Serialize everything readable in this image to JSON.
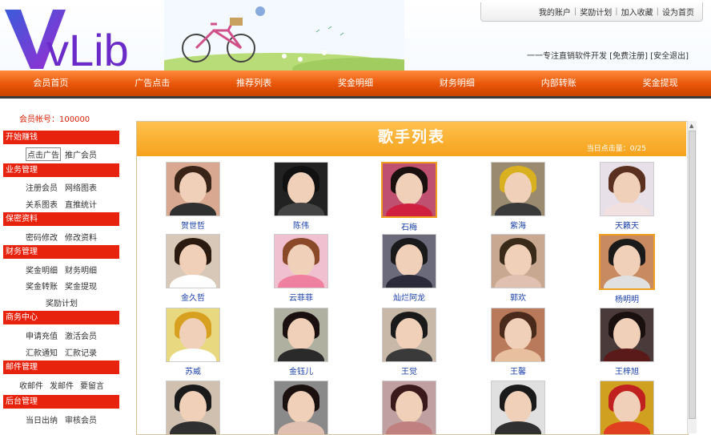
{
  "brand": {
    "logo_text": "vLib",
    "logo_v_color": "#3a2fc0",
    "accent": "#e85508"
  },
  "top_links": [
    "我的账户",
    "奖励计划",
    "加入收藏",
    "设为首页"
  ],
  "slogan": {
    "text": "一一专注直销软件开发",
    "links": [
      "[免费注册]",
      "[安全退出]"
    ]
  },
  "nav": [
    "会员首页",
    "广告点击",
    "推荐列表",
    "奖金明细",
    "财务明细",
    "内部转账",
    "奖金提现"
  ],
  "sidebar": {
    "account_label": "会员帐号：100000",
    "sections": [
      {
        "title": "开始赚钱",
        "items": [
          "点击广告",
          "推广会员"
        ]
      },
      {
        "title": "业务管理",
        "items": [
          "注册会员",
          "网络图表",
          "关系图表",
          "直推统计"
        ]
      },
      {
        "title": "保密资料",
        "items": [
          "密码修改",
          "修改资料"
        ]
      },
      {
        "title": "财务管理",
        "items": [
          "奖金明细",
          "财务明细",
          "奖金转账",
          "奖金提现",
          "奖励计划"
        ]
      },
      {
        "title": "商务中心",
        "items": [
          "申请充值",
          "激活会员",
          "汇款通知",
          "汇款记录"
        ]
      },
      {
        "title": "邮件管理",
        "items": [
          "收邮件",
          "发邮件",
          "要留言"
        ]
      },
      {
        "title": "后台管理",
        "items": [
          "当日出纳",
          "审核会员"
        ]
      }
    ]
  },
  "panel": {
    "title": "歌手列表",
    "clicks": "当日点击量：0/25"
  },
  "singers": [
    {
      "name": "贺世哲",
      "selected": false,
      "bg": "#d8a890",
      "hair": "#3a2418",
      "shirt": "#303030"
    },
    {
      "name": "陈伟",
      "selected": false,
      "bg": "#222222",
      "hair": "#111111",
      "shirt": "#444444"
    },
    {
      "name": "石梅",
      "selected": true,
      "bg": "#c05070",
      "hair": "#1a1010",
      "shirt": "#d02040"
    },
    {
      "name": "紫海",
      "selected": false,
      "bg": "#9a8a70",
      "hair": "#d8b020",
      "shirt": "#3a3a3a"
    },
    {
      "name": "天籁天",
      "selected": false,
      "bg": "#e8e0e8",
      "hair": "#5a3020",
      "shirt": "#f0e0e0"
    },
    {
      "name": "金久哲",
      "selected": false,
      "bg": "#d8c8b8",
      "hair": "#2a1a10",
      "shirt": "#ffffff"
    },
    {
      "name": "云菲菲",
      "selected": false,
      "bg": "#f0c0d0",
      "hair": "#8a4a2a",
      "shirt": "#f080a0"
    },
    {
      "name": "灿烂阿龙",
      "selected": false,
      "bg": "#6a6a7a",
      "hair": "#1a1a1a",
      "shirt": "#2a2a3a"
    },
    {
      "name": "郭欢",
      "selected": false,
      "bg": "#c8a890",
      "hair": "#3a2a1a",
      "shirt": "#e0c0b0"
    },
    {
      "name": "杨明明",
      "selected": true,
      "bg": "#c88a60",
      "hair": "#1a1a1a",
      "shirt": "#e0e0e0"
    },
    {
      "name": "苏威",
      "selected": false,
      "bg": "#e8d880",
      "hair": "#d8a020",
      "shirt": "#ffffff"
    },
    {
      "name": "金钰儿",
      "selected": false,
      "bg": "#b0b0a0",
      "hair": "#1a1010",
      "shirt": "#2a2a2a"
    },
    {
      "name": "王觉",
      "selected": false,
      "bg": "#c8b8a8",
      "hair": "#1a1a1a",
      "shirt": "#3a3a3a"
    },
    {
      "name": "王馨",
      "selected": false,
      "bg": "#b87a5a",
      "hair": "#4a2a1a",
      "shirt": "#e8c0a0"
    },
    {
      "name": "王梓旭",
      "selected": false,
      "bg": "#4a3a3a",
      "hair": "#1a1010",
      "shirt": "#5a1a1a"
    },
    {
      "name": "",
      "selected": false,
      "bg": "#d0c0b0",
      "hair": "#1a1a1a",
      "shirt": "#303030"
    },
    {
      "name": "",
      "selected": false,
      "bg": "#8a8a8a",
      "hair": "#1a1010",
      "shirt": "#e0c0b0"
    },
    {
      "name": "",
      "selected": false,
      "bg": "#c0a0a0",
      "hair": "#3a1a1a",
      "shirt": "#c08080"
    },
    {
      "name": "",
      "selected": false,
      "bg": "#e0e0e0",
      "hair": "#1a1a1a",
      "shirt": "#303030"
    },
    {
      "name": "",
      "selected": false,
      "bg": "#d0a020",
      "hair": "#c02020",
      "shirt": "#e04020"
    }
  ]
}
